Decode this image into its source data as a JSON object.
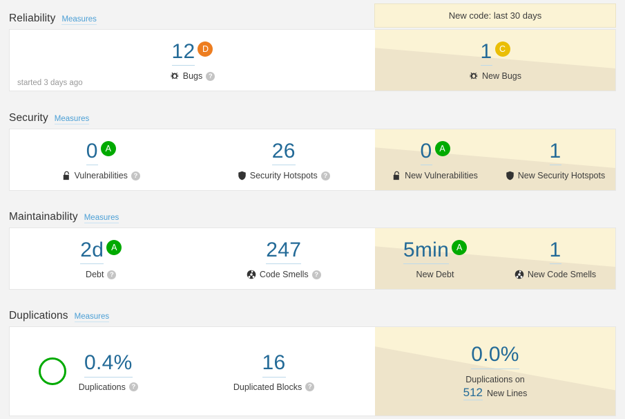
{
  "new_code_banner": {
    "label": "New code: last 30 days"
  },
  "colors": {
    "rating_a": "#00aa00",
    "rating_c": "#eabe06",
    "rating_d": "#ed7d20",
    "value_blue": "#236a97",
    "new_code_bg": "#fbf3d5",
    "new_code_bg_dark": "#eee4ca",
    "donut_green": "#00aa00"
  },
  "sections": [
    {
      "title": "Reliability",
      "measures_link": "Measures",
      "footer_note": "started 3 days ago",
      "overall": [
        {
          "value": "12",
          "rating": "D",
          "rating_class": "d",
          "label": "Bugs",
          "icon": "bug-icon",
          "help": true
        }
      ],
      "new_code": [
        {
          "value": "1",
          "rating": "C",
          "rating_class": "c",
          "label": "New Bugs",
          "icon": "bug-icon",
          "help": false
        }
      ]
    },
    {
      "title": "Security",
      "measures_link": "Measures",
      "footer_note": "",
      "overall": [
        {
          "value": "0",
          "rating": "A",
          "rating_class": "a",
          "label": "Vulnerabilities",
          "icon": "unlocked-padlock-icon",
          "help": true
        },
        {
          "value": "26",
          "rating": "",
          "rating_class": "",
          "label": "Security Hotspots",
          "icon": "shield-icon",
          "help": true
        }
      ],
      "new_code": [
        {
          "value": "0",
          "rating": "A",
          "rating_class": "a",
          "label": "New Vulnerabilities",
          "icon": "unlocked-padlock-icon",
          "help": false
        },
        {
          "value": "1",
          "rating": "",
          "rating_class": "",
          "label": "New Security Hotspots",
          "icon": "shield-icon",
          "help": false
        }
      ]
    },
    {
      "title": "Maintainability",
      "measures_link": "Measures",
      "footer_note": "",
      "overall": [
        {
          "value": "2d",
          "rating": "A",
          "rating_class": "a",
          "label": "Debt",
          "icon": "",
          "help": true
        },
        {
          "value": "247",
          "rating": "",
          "rating_class": "",
          "label": "Code Smells",
          "icon": "code-smell-icon",
          "help": true
        }
      ],
      "new_code": [
        {
          "value": "5min",
          "rating": "A",
          "rating_class": "a",
          "label": "New Debt",
          "icon": "",
          "help": false
        },
        {
          "value": "1",
          "rating": "",
          "rating_class": "",
          "label": "New Code Smells",
          "icon": "code-smell-icon",
          "help": false
        }
      ]
    },
    {
      "title": "Duplications",
      "measures_link": "Measures",
      "footer_note": "",
      "overall": [
        {
          "value": "0.4%",
          "rating": "",
          "rating_class": "",
          "label": "Duplications",
          "icon": "",
          "help": true
        },
        {
          "value": "16",
          "rating": "",
          "rating_class": "",
          "label": "Duplicated Blocks",
          "icon": "",
          "help": true
        }
      ],
      "new_code": [
        {
          "value": "0.0%",
          "label_prefix": "Duplications on",
          "new_lines_value": "512",
          "new_lines_label": "New Lines"
        }
      ]
    }
  ]
}
